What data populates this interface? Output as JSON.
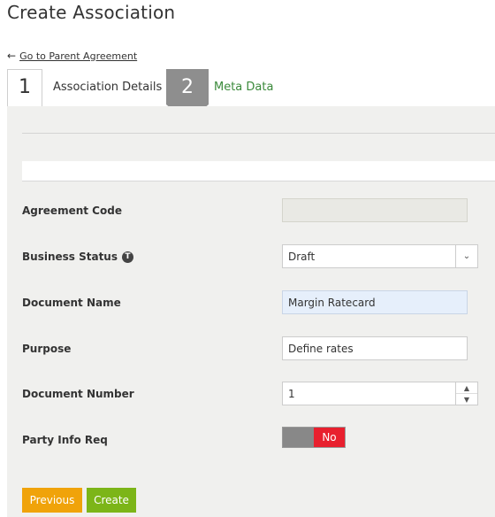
{
  "page": {
    "title": "Create Association"
  },
  "nav": {
    "back_label": "Go to Parent Agreement",
    "back_icon": "arrow-left-icon"
  },
  "steps": [
    {
      "number": "1",
      "label": "Association Details",
      "active": true
    },
    {
      "number": "2",
      "label": "Meta Data",
      "active": false
    }
  ],
  "form": {
    "agreement_code": {
      "label": "Agreement Code",
      "value": ""
    },
    "business_status": {
      "label": "Business Status",
      "info_icon": "info-icon",
      "value": "Draft"
    },
    "document_name": {
      "label": "Document Name",
      "value": "Margin Ratecard"
    },
    "purpose": {
      "label": "Purpose",
      "value": "Define rates"
    },
    "document_number": {
      "label": "Document Number",
      "value": "1"
    },
    "party_info_req": {
      "label": "Party Info Req",
      "value": "No"
    }
  },
  "buttons": {
    "previous": "Previous",
    "create": "Create"
  },
  "colors": {
    "previous": "#f0a30a",
    "create": "#7cb518",
    "toggle_no": "#e8202e",
    "step2_label": "#3b8a3b"
  }
}
